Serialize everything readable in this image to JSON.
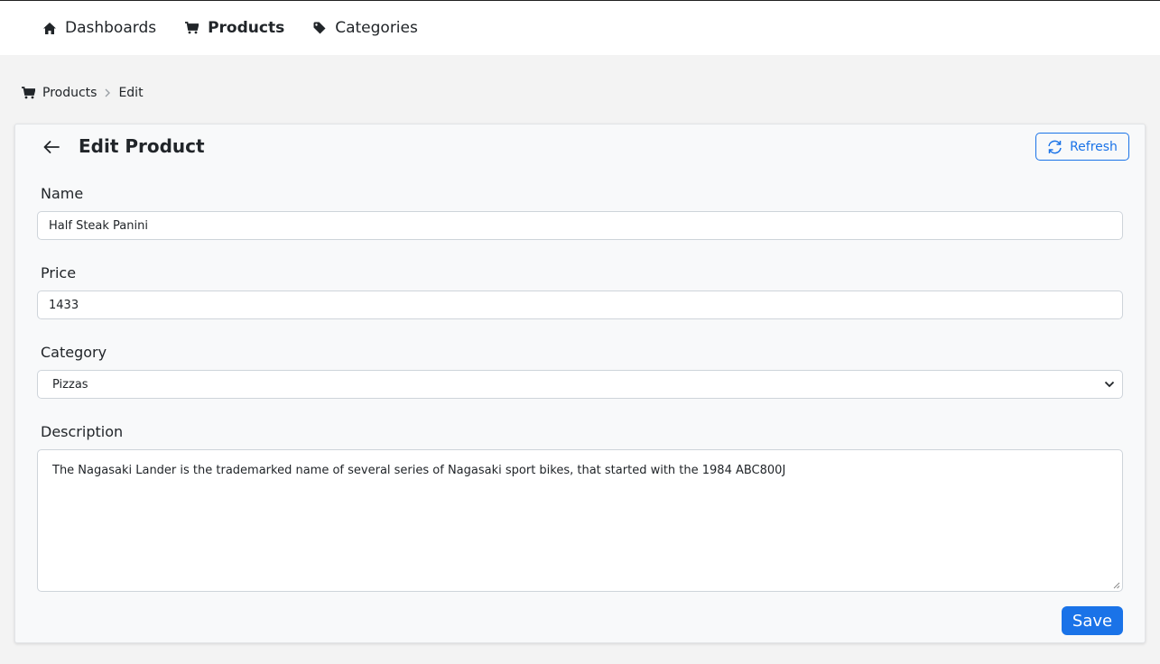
{
  "nav": {
    "items": [
      {
        "label": "Dashboards",
        "icon": "home-icon",
        "active": false
      },
      {
        "label": "Products",
        "icon": "cart-icon",
        "active": true
      },
      {
        "label": "Categories",
        "icon": "tag-icon",
        "active": false
      }
    ]
  },
  "breadcrumb": {
    "items": [
      {
        "label": "Products",
        "icon": "cart-icon"
      },
      {
        "label": "Edit"
      }
    ]
  },
  "card": {
    "title": "Edit Product",
    "refresh_label": "Refresh",
    "save_label": "Save"
  },
  "form": {
    "name_label": "Name",
    "name_value": "Half Steak Panini",
    "price_label": "Price",
    "price_value": "1433",
    "category_label": "Category",
    "category_value": "Pizzas",
    "description_label": "Description",
    "description_value": "The Nagasaki Lander is the trademarked name of several series of Nagasaki sport bikes, that started with the 1984 ABC800J"
  },
  "colors": {
    "accent": "#1a73e8",
    "background": "#f3f3f3",
    "card": "#f8f9fa"
  }
}
